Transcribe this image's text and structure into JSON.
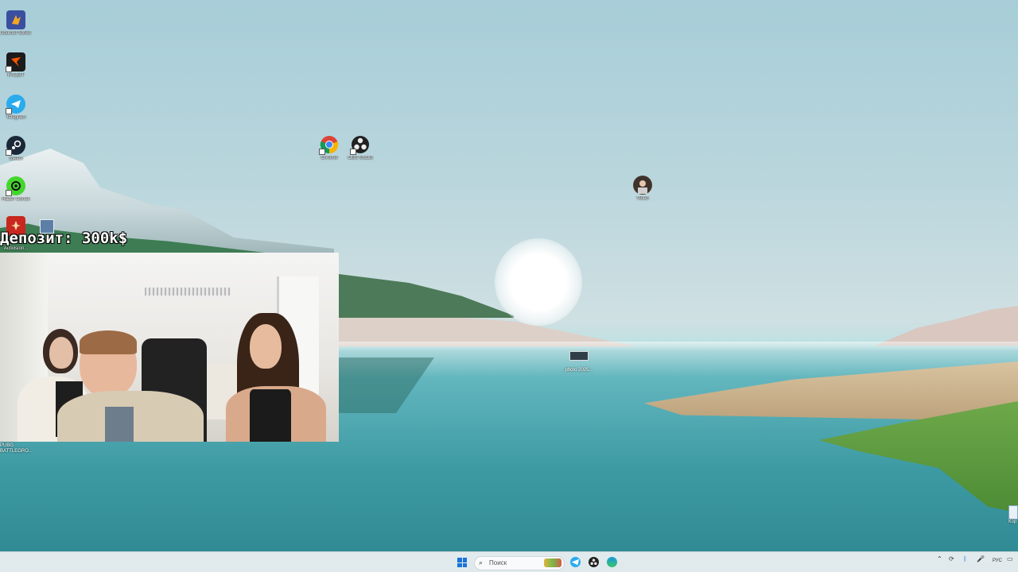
{
  "overlay": {
    "deposit_text": "Депозит: 300k$"
  },
  "desktop": {
    "icons_left": [
      {
        "label": "Counter-Strike 2",
        "icon": "counter-strike-icon",
        "color": "#3b4fa0"
      },
      {
        "label": "FACEIT",
        "icon": "faceit-icon",
        "color": "#ff5500"
      },
      {
        "label": "Telegram",
        "icon": "telegram-icon",
        "color": "#2aabee"
      },
      {
        "label": "Steam",
        "icon": "steam-icon",
        "color": "#1b2838"
      },
      {
        "label": "Razer Cortex",
        "icon": "razer-cortex-icon",
        "color": "#44d62c"
      },
      {
        "label": "Activision...",
        "icon": "game-launcher-icon",
        "color": "#c8281f"
      }
    ],
    "icons_mid": [
      {
        "label": "Chrome",
        "icon": "chrome-icon"
      },
      {
        "label": "OBS Studio",
        "icon": "obs-studio-icon"
      }
    ],
    "user_icon": {
      "label": "Video",
      "icon": "user-photo-icon"
    },
    "photo_file": {
      "label": "photo 2025...",
      "icon": "image-file-icon"
    },
    "pubg": {
      "label": "PUBG BATTLEGRO...",
      "icon": "pubg-icon"
    },
    "recycle_bin": {
      "label": "Кор",
      "icon": "recycle-bin-icon"
    }
  },
  "taskbar": {
    "search_placeholder": "Поиск",
    "apps": [
      {
        "name": "telegram",
        "icon": "telegram-icon",
        "color": "#2aabee"
      },
      {
        "name": "obs",
        "icon": "obs-studio-icon",
        "color": "#222222"
      },
      {
        "name": "edge",
        "icon": "edge-icon",
        "color": "#1c9bd8"
      }
    ],
    "language": "РУС"
  }
}
